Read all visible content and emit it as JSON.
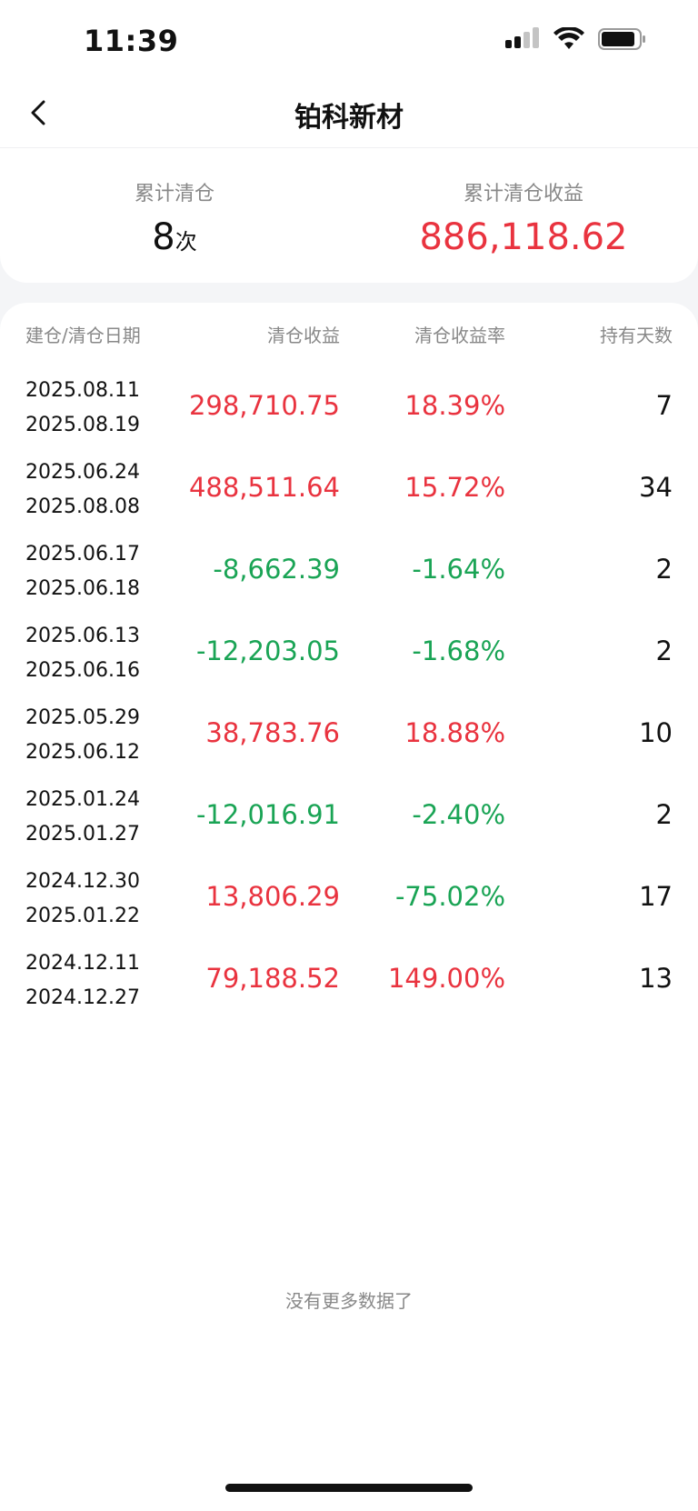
{
  "status_bar": {
    "time": "11:39",
    "icons": [
      "signal-icon",
      "wifi-icon",
      "battery-icon"
    ]
  },
  "nav": {
    "title": "铂科新材",
    "back_icon": "chevron-left-icon"
  },
  "summary": {
    "count_label": "累计清仓",
    "count_value": "8",
    "count_unit": "次",
    "profit_label": "累计清仓收益",
    "profit_value": "886,118.62"
  },
  "table": {
    "headers": {
      "date": "建仓/清仓日期",
      "profit": "清仓收益",
      "rate": "清仓收益率",
      "days": "持有天数"
    },
    "rows": [
      {
        "open": "2025.08.11",
        "close": "2025.08.19",
        "profit": "298,710.75",
        "rate": "18.39%",
        "days": "7",
        "trend": "red"
      },
      {
        "open": "2025.06.24",
        "close": "2025.08.08",
        "profit": "488,511.64",
        "rate": "15.72%",
        "days": "34",
        "trend": "red"
      },
      {
        "open": "2025.06.17",
        "close": "2025.06.18",
        "profit": "-8,662.39",
        "rate": "-1.64%",
        "days": "2",
        "trend": "green"
      },
      {
        "open": "2025.06.13",
        "close": "2025.06.16",
        "profit": "-12,203.05",
        "rate": "-1.68%",
        "days": "2",
        "trend": "green"
      },
      {
        "open": "2025.05.29",
        "close": "2025.06.12",
        "profit": "38,783.76",
        "rate": "18.88%",
        "days": "10",
        "trend": "red"
      },
      {
        "open": "2025.01.24",
        "close": "2025.01.27",
        "profit": "-12,016.91",
        "rate": "-2.40%",
        "days": "2",
        "trend": "green"
      },
      {
        "open": "2024.12.30",
        "close": "2025.01.22",
        "profit": "13,806.29",
        "rate": "-75.02%",
        "days": "17",
        "trend": "mixed"
      },
      {
        "open": "2024.12.11",
        "close": "2024.12.27",
        "profit": "79,188.52",
        "rate": "149.00%",
        "days": "13",
        "trend": "red"
      }
    ]
  },
  "footer": {
    "no_more": "没有更多数据了"
  },
  "colors": {
    "red": "#e9333f",
    "green": "#1aa455",
    "label": "#888888",
    "background": "#f4f5f7"
  }
}
